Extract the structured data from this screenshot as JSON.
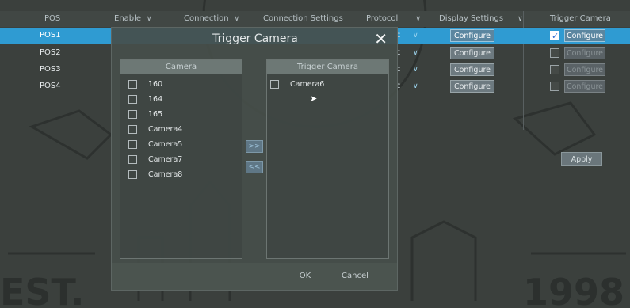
{
  "table": {
    "headers": [
      {
        "label": "POS",
        "chevron": false
      },
      {
        "label": "Enable",
        "chevron": true
      },
      {
        "label": "Connection",
        "chevron": true
      },
      {
        "label": "Connection Settings",
        "chevron": false
      },
      {
        "label": "Protocol",
        "chevron": true
      },
      {
        "label": "Display Settings",
        "chevron": true
      },
      {
        "label": "Trigger Camera",
        "chevron": false
      }
    ],
    "rows": [
      {
        "pos": "POS1",
        "protocol_tail": "c",
        "display": "Configure",
        "trigger_checked": true,
        "trigger": "Configure",
        "selected": true
      },
      {
        "pos": "POS2",
        "protocol_tail": "c",
        "display": "Configure",
        "trigger_checked": false,
        "trigger": "Configure",
        "selected": false
      },
      {
        "pos": "POS3",
        "protocol_tail": "c",
        "display": "Configure",
        "trigger_checked": false,
        "trigger": "Configure",
        "selected": false
      },
      {
        "pos": "POS4",
        "protocol_tail": "c",
        "display": "Configure",
        "trigger_checked": false,
        "trigger": "Configure",
        "selected": false
      }
    ],
    "apply_label": "Apply"
  },
  "background": {
    "left_text": "EST.",
    "right_text": "1998"
  },
  "dialog": {
    "title": "Trigger Camera",
    "close_icon": "close-icon",
    "camera_panel": {
      "header": "Camera",
      "items": [
        "160",
        "164",
        "165",
        "Camera4",
        "Camera5",
        "Camera7",
        "Camera8"
      ]
    },
    "trigger_panel": {
      "header": "Trigger Camera",
      "items": [
        "Camera6"
      ]
    },
    "add_label": ">>",
    "remove_label": "<<",
    "ok_label": "OK",
    "cancel_label": "Cancel"
  },
  "colors": {
    "selected_row": "#2f9bd2",
    "background": "#3b403d"
  }
}
